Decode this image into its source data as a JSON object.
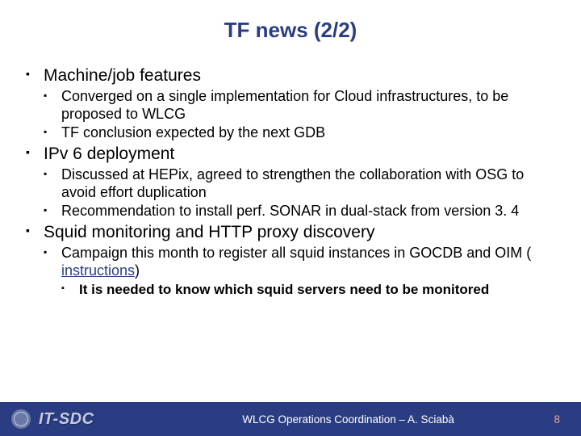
{
  "title": "TF news (2/2)",
  "topics": [
    {
      "heading": "Machine/job features",
      "points": [
        "Converged on a single implementation for Cloud infrastructures, to be proposed to WLCG",
        "TF conclusion expected by the next GDB"
      ]
    },
    {
      "heading": "IPv 6 deployment",
      "points": [
        "Discussed at HEPix, agreed to strengthen the collaboration with OSG to avoid effort duplication",
        "Recommendation to install perf. SONAR in dual-stack from version 3. 4"
      ]
    },
    {
      "heading": "Squid monitoring and HTTP proxy discovery",
      "points": [
        {
          "before": "Campaign this month to register all squid instances in GOCDB and OIM (",
          "link": "instructions",
          "after": ")",
          "sub": [
            "It is needed to know which squid servers need to be monitored"
          ]
        }
      ]
    }
  ],
  "footer": {
    "left": "IT-SDC",
    "center": "WLCG Operations Coordination – A. Sciabà",
    "page": "8"
  }
}
